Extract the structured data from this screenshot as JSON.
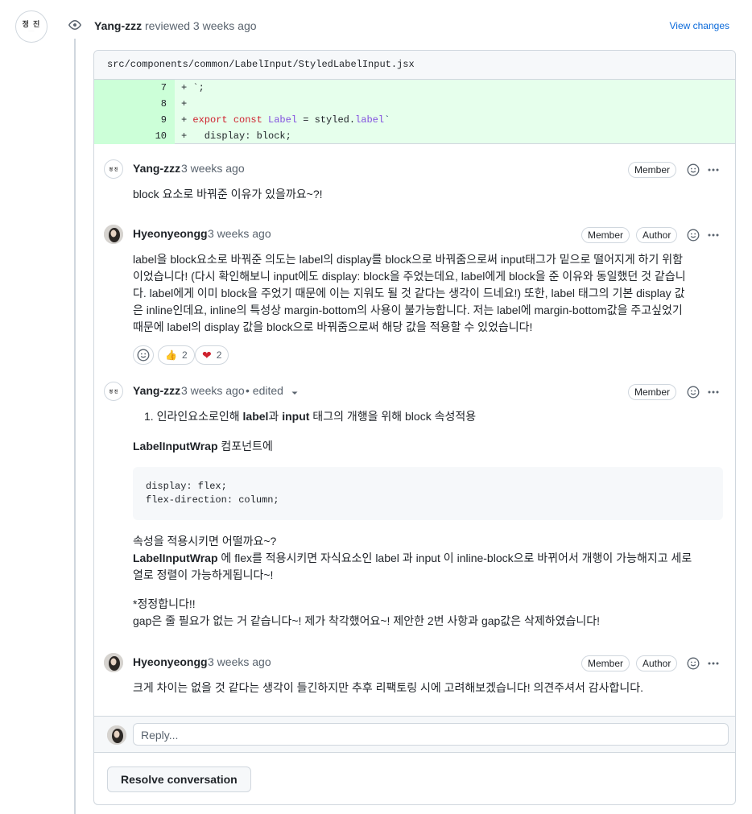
{
  "review": {
    "user": "Yang-zzz",
    "action": "reviewed 3 weeks ago",
    "view_changes": "View changes",
    "avatar_text": "정 진"
  },
  "file": {
    "path": "src/components/common/LabelInput/StyledLabelInput.jsx",
    "lines": [
      {
        "num": "7",
        "code": "+ `;"
      },
      {
        "num": "8",
        "code": "+"
      },
      {
        "num": "9",
        "code": "+ export const Label = styled.label`"
      },
      {
        "num": "10",
        "code": "+   display: block;"
      }
    ]
  },
  "comments": [
    {
      "user": "Yang-zzz",
      "time": "3 weeks ago",
      "badges": [
        "Member"
      ],
      "body": "block 요소로 바꿔준 이유가 있을까요~?!"
    },
    {
      "user": "Hyeonyeongg",
      "time": "3 weeks ago",
      "badges": [
        "Member",
        "Author"
      ],
      "body_lines": [
        "label을 block요소로 바꿔준 의도는 label의 display를 block으로 바꿔줌으로써 input태그가 밑으로 떨어지게 하기 위함",
        "이었습니다! (다시 확인해보니 input에도 display: block을 주었는데요, label에게 block을 준 이유와 동일했던 것 같습니",
        "다. label에게 이미 block을 주었기 때문에 이는 지워도 될 것 같다는 생각이 드네요!) 또한, label 태그의 기본 display 값",
        "은 inline인데요, inline의 특성상 margin-bottom의 사용이 불가능합니다. 저는 label에 margin-bottom값을 주고싶었기",
        "때문에 label의 display 값을 block으로 바꿔줌으로써 해당 값을 적용할 수 있었습니다!"
      ],
      "reactions": [
        {
          "emoji": "👍",
          "count": "2"
        },
        {
          "emoji": "❤️",
          "count": "2"
        }
      ]
    },
    {
      "user": "Yang-zzz",
      "time": "3 weeks ago",
      "edited": "• edited",
      "badges": [
        "Member"
      ],
      "list_item": {
        "num": "1.",
        "pre": "인라인요소로인해 ",
        "b1": "label",
        "mid": "과 ",
        "b2": "input",
        "post": " 태그의 개행을 위해 block 속성적용"
      },
      "wrap_bold": "LabelInputWrap",
      "wrap_rest": " 컴포넌트에",
      "code_lines": [
        "display: flex;",
        "flex-direction: column;"
      ],
      "para1": "속성을 적용시키면 어떨까요~?",
      "para2_bold": "LabelInputWrap",
      "para2_line1": " 에 flex를 적용시키면 자식요소인 label 과 input 이 inline-block으로 바뀌어서 개행이 가능해지고 세로",
      "para2_line2": "열로 정렬이 가능하게됩니다~!",
      "para3_line1": "*정정합니다!!",
      "para3_line2": "gap은 줄 필요가 없는 거 같습니다~! 제가 착각했어요~! 제안한 2번 사항과 gap값은 삭제하였습니다!"
    },
    {
      "user": "Hyeonyeongg",
      "time": "3 weeks ago",
      "badges": [
        "Member",
        "Author"
      ],
      "body": "크게 차이는 없을 것 같다는 생각이 들긴하지만 추후 리팩토링 시에 고려해보겠습니다! 의견주셔서 감사합니다."
    }
  ],
  "reply_placeholder": "Reply...",
  "resolve_label": "Resolve conversation",
  "colors": {
    "link": "#0969da",
    "diff_bg": "#e6ffec",
    "diff_num_bg": "#ccffd8",
    "heart": "#cf222e"
  }
}
